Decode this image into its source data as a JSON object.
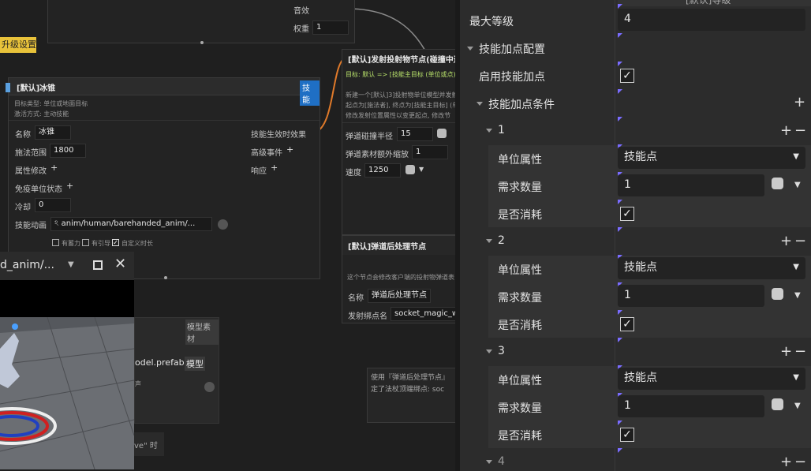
{
  "canvas": {
    "top_node": {
      "sfx_label": "音效",
      "weight_label": "权重",
      "weight_value": "1"
    },
    "upgrade_tag": "升级设置",
    "ice_node": {
      "title": "[默认]冰锥",
      "badge": "技能",
      "desc1": "目标类型: 单位或地面目标",
      "desc2": "激活方式: 主动技能",
      "name_label": "名称",
      "name_value": "冰锥",
      "range_label": "施法范围",
      "range_value": "1800",
      "attr_label": "属性修改",
      "immune_label": "免疫单位状态",
      "cooldown_label": "冷却",
      "cooldown_value": "0",
      "anim_label": "技能动画",
      "anim_value": "anim/human/barehanded_anim/...",
      "effect_label": "技能生效时效果",
      "adv_label": "高级事件",
      "resp_label": "响应",
      "chk1": "有蓄力",
      "chk2": "有引导",
      "chk3": "自定义时长"
    },
    "proj_node": {
      "title": "[默认]发射投射物节点(碰撞中途",
      "target_line": "目标: 默认 => [技能主目标 (单位或点)",
      "text1": "新建一个[默认]3]投射物单位模型并发射",
      "text2": "起点为[施法者], 终点为[技能主目标] (单",
      "text3": "修改发射位置属性以变更起点, 修改节",
      "radius_label": "弹道碰撞半径",
      "radius_value": "15",
      "scale_label": "弹道素材额外缩放",
      "scale_value": "1",
      "speed_label": "速度",
      "speed_value": "1250"
    },
    "post_node": {
      "title": "[默认]弹道后处理节点",
      "desc": "这个节点会修改客户端的投射物弹道表",
      "name_label": "名称",
      "name_value": "弹道后处理节点",
      "socket_label": "发射绑点名",
      "socket_value": "socket_magic_w"
    },
    "note_node": {
      "line1": "使用『弹道后处理节点』",
      "line2": "定了法杖顶端绑点: soc"
    },
    "preview": {
      "title": "d_anim/...",
      "model_tag": "模型素材",
      "prefab": "odel.prefab",
      "model_btn": "模型",
      "sound_label": "声",
      "bottom_text": "ve\" 时"
    }
  },
  "panel": {
    "top_partial": "[默认]等级",
    "max_level_label": "最大等级",
    "max_level_value": "4",
    "config_label": "技能加点配置",
    "enable_label": "启用技能加点",
    "enable_checked": true,
    "cond_label": "技能加点条件",
    "conditions": [
      {
        "index": "1",
        "attr_label": "单位属性",
        "attr_value": "技能点",
        "req_label": "需求数量",
        "req_value": "1",
        "consume_label": "是否消耗"
      },
      {
        "index": "2",
        "attr_label": "单位属性",
        "attr_value": "技能点",
        "req_label": "需求数量",
        "req_value": "1",
        "consume_label": "是否消耗"
      },
      {
        "index": "3",
        "attr_label": "单位属性",
        "attr_value": "技能点",
        "req_label": "需求数量",
        "req_value": "1",
        "consume_label": "是否消耗"
      }
    ],
    "next_index": "4"
  }
}
